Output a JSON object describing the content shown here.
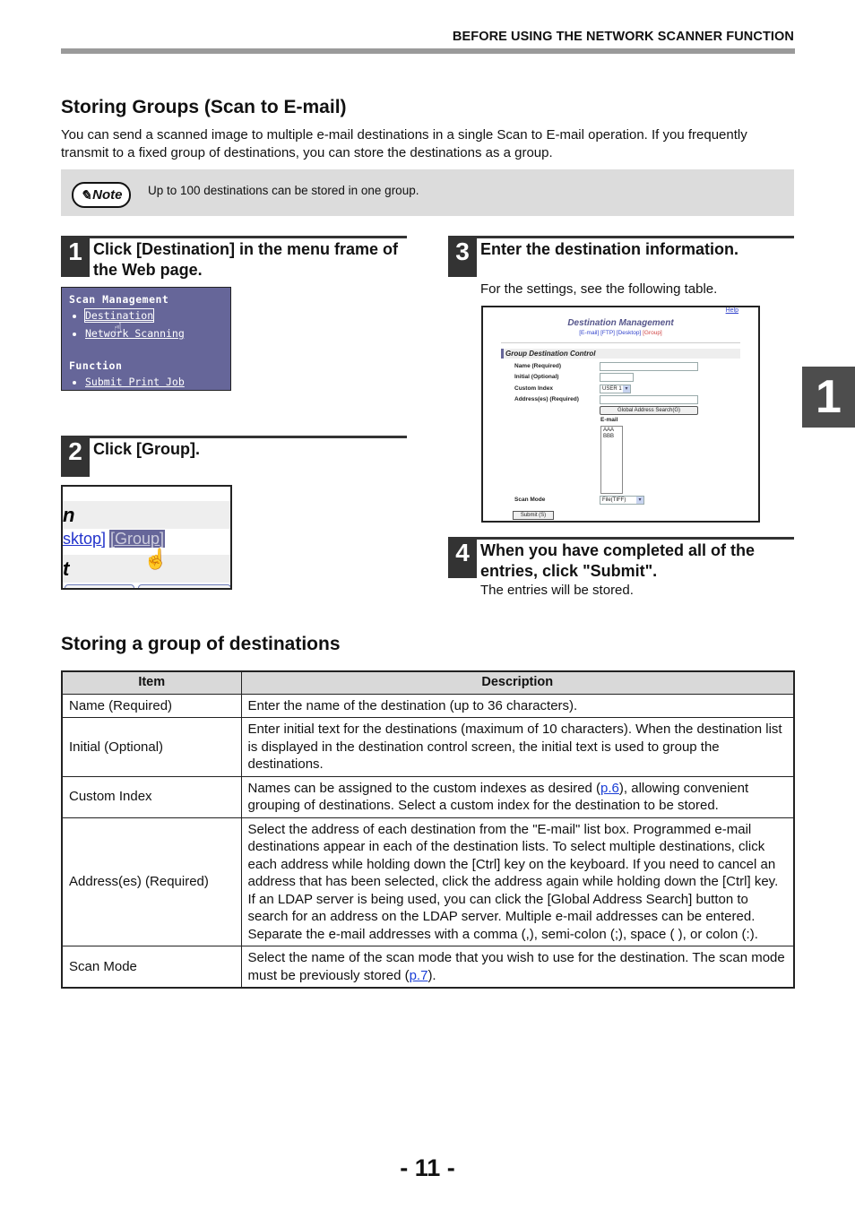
{
  "header": {
    "title": "BEFORE USING THE NETWORK SCANNER FUNCTION"
  },
  "section1": {
    "title": "Storing Groups (Scan to E-mail)",
    "intro": "You can send a scanned image to multiple e-mail destinations in a single Scan to E-mail operation. If you frequently transmit to a fixed group of destinations, you can store the destinations as a group."
  },
  "note": {
    "badge": "Note",
    "text": "Up to 100 destinations can be stored in one group."
  },
  "steps": [
    {
      "num": "1",
      "title": "Click [Destination] in the menu frame of the Web page."
    },
    {
      "num": "2",
      "title": "Click [Group]."
    },
    {
      "num": "3",
      "title": "Enter the destination information.",
      "sub": "For the settings, see the following table."
    },
    {
      "num": "4",
      "title": "When you have completed all of the entries, click \"Submit\".",
      "sub": "The entries will be stored."
    }
  ],
  "shot1": {
    "group1": "Scan Management",
    "links1": [
      "Destination",
      "Network Scanning"
    ],
    "group2": "Function",
    "links2": [
      "Submit Print Job"
    ]
  },
  "shot2": {
    "row1": "n",
    "link_prev": "sktop]",
    "link_group": "[Group]",
    "row3": "t"
  },
  "shot3": {
    "help": "Help",
    "title": "Destination Management",
    "tabs": [
      "[E-mail]",
      "[FTP]",
      "[Desktop]",
      "[Group]"
    ],
    "section": "Group Destination Control",
    "labels": {
      "name": "Name (Required)",
      "initial": "Initial (Optional)",
      "custom_index": "Custom Index",
      "address": "Address(es) (Required)",
      "scan_mode": "Scan Mode"
    },
    "custom_index_value": "USER 1",
    "global_search_button": "Global Address Search(G)",
    "email_label": "E-mail",
    "email_list": [
      "AAA",
      "BBB"
    ],
    "scan_mode_value": "File(TIFF)",
    "submit_button": "Submit (S)"
  },
  "chapter_tab": "1",
  "section2": {
    "title": "Storing a group of destinations"
  },
  "table": {
    "headers": [
      "Item",
      "Description"
    ],
    "rows": [
      {
        "item": "Name (Required)",
        "desc": "Enter the name of the destination (up to 36 characters)."
      },
      {
        "item": "Initial (Optional)",
        "desc": "Enter initial text for the destinations (maximum of 10 characters). When the destination list is displayed in the destination control screen, the initial text is used to group the destinations."
      },
      {
        "item": "Custom Index",
        "desc_pre": "Names can be assigned to the custom indexes as desired (",
        "link": "p.6",
        "desc_post": "), allowing convenient grouping of destinations. Select a custom index for the destination to be stored."
      },
      {
        "item": "Address(es) (Required)",
        "desc": "Select the address of each destination from the \"E-mail\" list box. Programmed e-mail destinations appear in each of the destination lists. To select multiple destinations, click each address while holding down the [Ctrl] key on the keyboard. If you need to cancel an address that has been selected, click the address again while holding down the [Ctrl] key.",
        "desc2": "If an LDAP server is being used, you can click the [Global Address Search] button to search for an address on the LDAP server. Multiple e-mail addresses can be entered. Separate the e-mail addresses with a comma (,), semi-colon (;), space ( ), or colon (:)."
      },
      {
        "item": "Scan Mode",
        "desc_pre": "Select the name of the scan mode that you wish to use for the destination. The scan mode must be previously stored (",
        "link": "p.7",
        "desc_post": ")."
      }
    ]
  },
  "page_number": "- 11 -"
}
